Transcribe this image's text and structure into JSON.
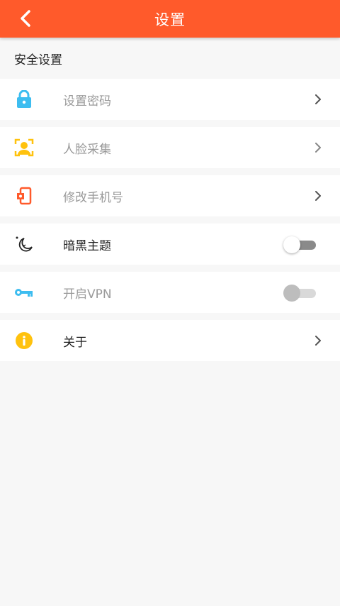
{
  "header": {
    "title": "设置"
  },
  "section": {
    "title": "安全设置"
  },
  "items": [
    {
      "label": "设置密码",
      "icon": "lock-icon",
      "control": "chevron",
      "enabled": true
    },
    {
      "label": "人脸采集",
      "icon": "face-scan-icon",
      "control": "chevron",
      "enabled": true
    },
    {
      "label": "修改手机号",
      "icon": "phone-settings-icon",
      "control": "chevron",
      "enabled": true
    },
    {
      "label": "暗黑主题",
      "icon": "moon-icon",
      "control": "toggle",
      "on": false,
      "enabled": true
    },
    {
      "label": "开启VPN",
      "icon": "key-icon",
      "control": "toggle",
      "on": false,
      "enabled": false
    },
    {
      "label": "关于",
      "icon": "info-icon",
      "control": "chevron",
      "enabled": true
    }
  ],
  "colors": {
    "header_bg": "#ff5a2b",
    "lock": "#3dbdf0",
    "face": "#ffc20e",
    "phone": "#ff5a2b",
    "key": "#3dbdf0",
    "info": "#ffc20e"
  }
}
